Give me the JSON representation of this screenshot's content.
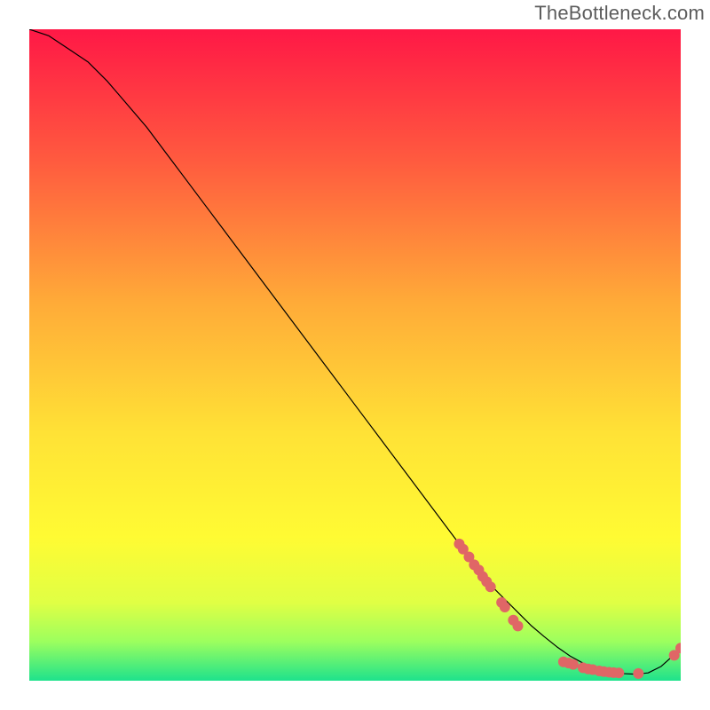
{
  "watermark": "TheBottleneck.com",
  "chart_data": {
    "type": "line",
    "title": "",
    "xlabel": "",
    "ylabel": "",
    "xlim": [
      0,
      100
    ],
    "ylim": [
      0,
      100
    ],
    "axes": "none",
    "background_gradient": {
      "top": "#ff1846",
      "mid_upper": "#ff7d3d",
      "mid": "#ffde37",
      "mid_lower": "#fff933",
      "lower": "#d7ff4d",
      "bottom": "#1ee28c"
    },
    "series": [
      {
        "name": "curve",
        "type": "line",
        "color": "#000000",
        "width": 1.2,
        "x": [
          0,
          3,
          6,
          9,
          12,
          15,
          18,
          21,
          24,
          27,
          30,
          33,
          36,
          39,
          42,
          45,
          48,
          51,
          54,
          57,
          60,
          63,
          66,
          69,
          71,
          73,
          75,
          77,
          79,
          81,
          83,
          85,
          87,
          89,
          91,
          93,
          95,
          97,
          99,
          100
        ],
        "y": [
          100,
          99,
          97,
          95,
          92,
          88.5,
          85,
          81,
          77,
          73,
          69,
          65,
          61,
          57,
          53,
          49,
          45,
          41,
          37,
          33,
          29,
          25,
          21,
          17,
          14.5,
          12.5,
          10.5,
          8.5,
          6.8,
          5.2,
          3.8,
          2.7,
          1.9,
          1.4,
          1.1,
          1.0,
          1.2,
          2.2,
          4.0,
          5.0
        ]
      },
      {
        "name": "cluster-diagonal",
        "type": "scatter",
        "color": "#e06666",
        "radius": 6,
        "x": [
          66.0,
          66.6,
          67.5,
          68.3,
          69.0,
          69.6,
          70.2,
          70.8,
          72.5,
          73.0,
          74.3,
          75.0
        ],
        "y": [
          21.0,
          20.2,
          19.0,
          17.8,
          17.0,
          16.0,
          15.2,
          14.4,
          12.0,
          11.3,
          9.3,
          8.4
        ]
      },
      {
        "name": "cluster-bottom",
        "type": "scatter",
        "color": "#e06666",
        "radius": 6,
        "x": [
          82.0,
          82.8,
          83.5,
          85.0,
          85.8,
          86.5,
          87.5,
          88.2,
          89.0,
          89.7,
          90.5,
          93.5,
          99.0,
          100.0
        ],
        "y": [
          2.9,
          2.7,
          2.5,
          2.0,
          1.8,
          1.7,
          1.5,
          1.4,
          1.3,
          1.25,
          1.2,
          1.1,
          3.9,
          5.0
        ]
      }
    ]
  }
}
